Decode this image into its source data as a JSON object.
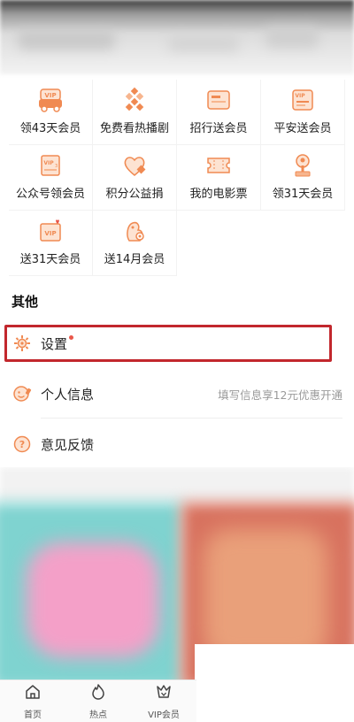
{
  "benefits": [
    {
      "label": "领43天会员",
      "icon": "vip-car-icon"
    },
    {
      "label": "免费看热播剧",
      "icon": "diamond-pattern-icon"
    },
    {
      "label": "招行送会员",
      "icon": "card-icon"
    },
    {
      "label": "平安送会员",
      "icon": "vip-card-icon"
    },
    {
      "label": "公众号领会员",
      "icon": "vip-ticket-icon"
    },
    {
      "label": "积分公益捐",
      "icon": "heart-icon"
    },
    {
      "label": "我的电影票",
      "icon": "movie-ticket-icon"
    },
    {
      "label": "领31天会员",
      "icon": "gift-tree-icon"
    },
    {
      "label": "送31天会员",
      "icon": "vip-heart-icon"
    },
    {
      "label": "送14月会员",
      "icon": "mascot-icon"
    }
  ],
  "other": {
    "title": "其他",
    "settings": {
      "label": "设置"
    },
    "profile": {
      "label": "个人信息",
      "hint": "填写信息享12元优惠开通"
    },
    "feedback": {
      "label": "意见反馈"
    }
  },
  "tabs": [
    {
      "label": "首页",
      "icon": "home-icon"
    },
    {
      "label": "热点",
      "icon": "flame-icon"
    },
    {
      "label": "VIP会员",
      "icon": "vip-crown-icon"
    }
  ],
  "colors": {
    "accent": "#f08a52",
    "highlight": "#c2272d",
    "badge": "#e9574a"
  }
}
